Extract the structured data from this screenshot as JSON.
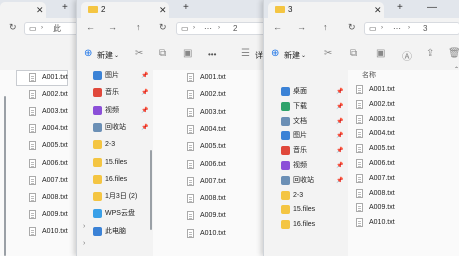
{
  "window1": {
    "addr_text": "此",
    "files": [
      "A001.txt",
      "A002.txt",
      "A003.txt",
      "A004.txt",
      "A005.txt",
      "A006.txt",
      "A007.txt",
      "A008.txt",
      "A009.txt",
      "A010.txt"
    ]
  },
  "window2": {
    "tab_title": "2",
    "addr_sep": "⋯",
    "addr_text": "2",
    "new_label": "新建",
    "more_label": "•••",
    "sort_partial": "详",
    "nav": [
      {
        "label": "图片",
        "icon": "pictures-icon",
        "color": "#3b82d6"
      },
      {
        "label": "音乐",
        "icon": "music-icon",
        "color": "#e0483b"
      },
      {
        "label": "视频",
        "icon": "video-icon",
        "color": "#8b4fd8"
      },
      {
        "label": "回收站",
        "icon": "recycle-bin-icon",
        "color": "#6b8fb5"
      },
      {
        "label": "2-3",
        "icon": "folder-icon",
        "color": "#f4c542"
      },
      {
        "label": "15.files",
        "icon": "folder-icon",
        "color": "#f4c542"
      },
      {
        "label": "16.files",
        "icon": "folder-icon",
        "color": "#f4c542"
      },
      {
        "label": "1月3日 (2)",
        "icon": "folder-icon",
        "color": "#f4c542"
      },
      {
        "label": "WPS云盘",
        "icon": "cloud-icon",
        "color": "#3aa0e8"
      },
      {
        "label": "此电脑",
        "icon": "computer-icon",
        "color": "#3b82d6"
      }
    ],
    "files": [
      "A001.txt",
      "A002.txt",
      "A003.txt",
      "A004.txt",
      "A005.txt",
      "A006.txt",
      "A007.txt",
      "A008.txt",
      "A009.txt",
      "A010.txt"
    ]
  },
  "window3": {
    "tab_title": "3",
    "addr_sep": "⋯",
    "addr_text": "3",
    "new_label": "新建",
    "more_label": "•••",
    "col_name": "名称",
    "nav": [
      {
        "label": "桌面",
        "icon": "desktop-icon",
        "color": "#3b82d6"
      },
      {
        "label": "下载",
        "icon": "download-icon",
        "color": "#2ea36b"
      },
      {
        "label": "文档",
        "icon": "documents-icon",
        "color": "#6b8fb5"
      },
      {
        "label": "图片",
        "icon": "pictures-icon",
        "color": "#3b82d6"
      },
      {
        "label": "音乐",
        "icon": "music-icon",
        "color": "#e0483b"
      },
      {
        "label": "视频",
        "icon": "video-icon",
        "color": "#8b4fd8"
      },
      {
        "label": "回收站",
        "icon": "recycle-bin-icon",
        "color": "#6b8fb5"
      },
      {
        "label": "2-3",
        "icon": "folder-icon",
        "color": "#f4c542"
      },
      {
        "label": "15.files",
        "icon": "folder-icon",
        "color": "#f4c542"
      },
      {
        "label": "16.files",
        "icon": "folder-icon",
        "color": "#f4c542"
      }
    ],
    "files": [
      "A001.txt",
      "A002.txt",
      "A003.txt",
      "A004.txt",
      "A005.txt",
      "A006.txt",
      "A007.txt",
      "A008.txt",
      "A009.txt",
      "A010.txt"
    ]
  }
}
